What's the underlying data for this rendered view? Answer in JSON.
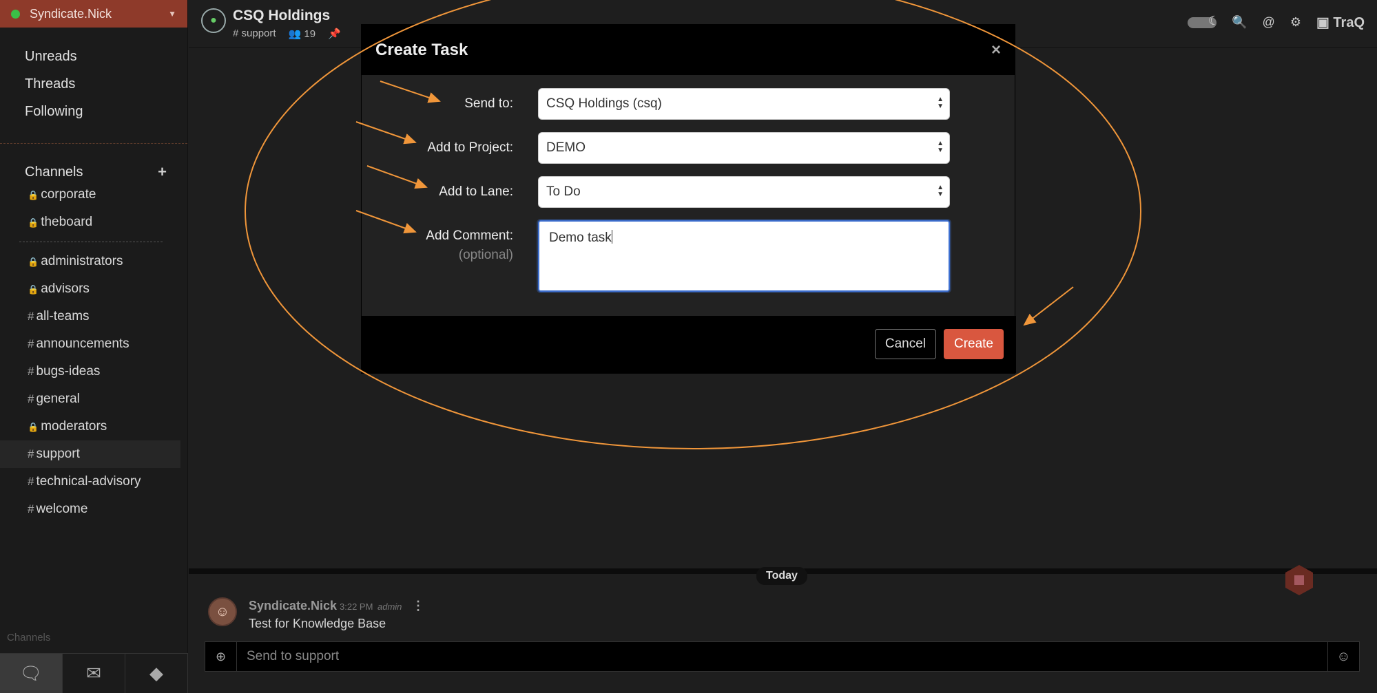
{
  "sidebar": {
    "team_name": "Syndicate.Nick",
    "nav": [
      "Unreads",
      "Threads",
      "Following"
    ],
    "channels_header": "Channels",
    "private_channels": [
      {
        "prefix": "🔒",
        "name": "corporate"
      },
      {
        "prefix": "🔒",
        "name": "theboard"
      }
    ],
    "channels": [
      {
        "prefix": "🔒",
        "name": "administrators"
      },
      {
        "prefix": "🔒",
        "name": "advisors"
      },
      {
        "prefix": "#",
        "name": "all-teams"
      },
      {
        "prefix": "#",
        "name": "announcements"
      },
      {
        "prefix": "#",
        "name": "bugs-ideas"
      },
      {
        "prefix": "#",
        "name": "general"
      },
      {
        "prefix": "🔒",
        "name": "moderators"
      },
      {
        "prefix": "#",
        "name": "support"
      },
      {
        "prefix": "#",
        "name": "technical-advisory"
      },
      {
        "prefix": "#",
        "name": "welcome"
      }
    ],
    "active_channel": "support",
    "footer_label": "Channels"
  },
  "header": {
    "team_title": "CSQ Holdings",
    "channel": "support",
    "members": "19",
    "brand": "TraQ"
  },
  "modal": {
    "title": "Create Task",
    "close": "×",
    "send_to_label": "Send to:",
    "send_to_value": "CSQ Holdings (csq)",
    "project_label": "Add to Project:",
    "project_value": "DEMO",
    "lane_label": "Add to Lane:",
    "lane_value": "To Do",
    "comment_label": "Add Comment:",
    "comment_optional": "(optional)",
    "comment_value": "Demo task",
    "cancel": "Cancel",
    "create": "Create"
  },
  "feed": {
    "day_label": "Today",
    "author": "Syndicate.Nick",
    "time": "3:22 PM",
    "role": "admin",
    "text": "Test for Knowledge Base",
    "composer_placeholder": "Send to support"
  },
  "colors": {
    "accent": "#d9573f",
    "annotation": "#f0963a",
    "team_header": "#8e3a2a",
    "online": "#3bbf47"
  }
}
